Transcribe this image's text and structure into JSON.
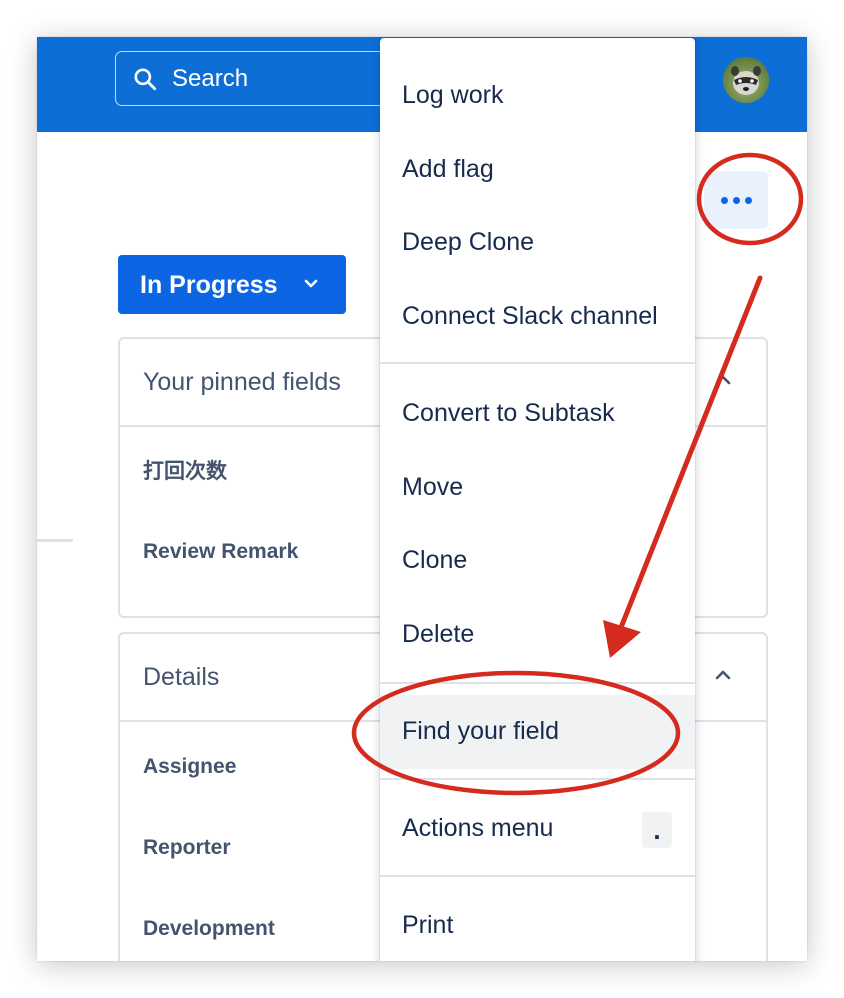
{
  "header": {
    "search_placeholder": "Search",
    "avatar": "avatar-raccoon-icon"
  },
  "issue": {
    "status_label": "In Progress"
  },
  "panels": {
    "pinned": {
      "title": "Your pinned fields",
      "fields": [
        "打回次数",
        "Review Remark"
      ]
    },
    "details": {
      "title": "Details",
      "fields": [
        "Assignee",
        "Reporter",
        "Development"
      ]
    }
  },
  "actions_menu": {
    "groups": [
      [
        "Log work",
        "Add flag",
        "Deep Clone",
        "Connect Slack channel"
      ],
      [
        "Convert to Subtask",
        "Move",
        "Clone",
        "Delete"
      ],
      [
        "Find your field"
      ],
      [
        "Actions menu"
      ],
      [
        "Print"
      ]
    ],
    "highlighted_item": "Find your field",
    "actions_menu_shortcut": "."
  },
  "annotation": {
    "color": "#d52b1e",
    "targets": [
      "more-actions-button",
      "menu-item-find-your-field"
    ]
  },
  "colors": {
    "header_bg": "#0d6fd6",
    "primary": "#0c66e4",
    "text": "#172b4d",
    "subtle_text": "#44546f",
    "border": "#dfe1e6"
  }
}
